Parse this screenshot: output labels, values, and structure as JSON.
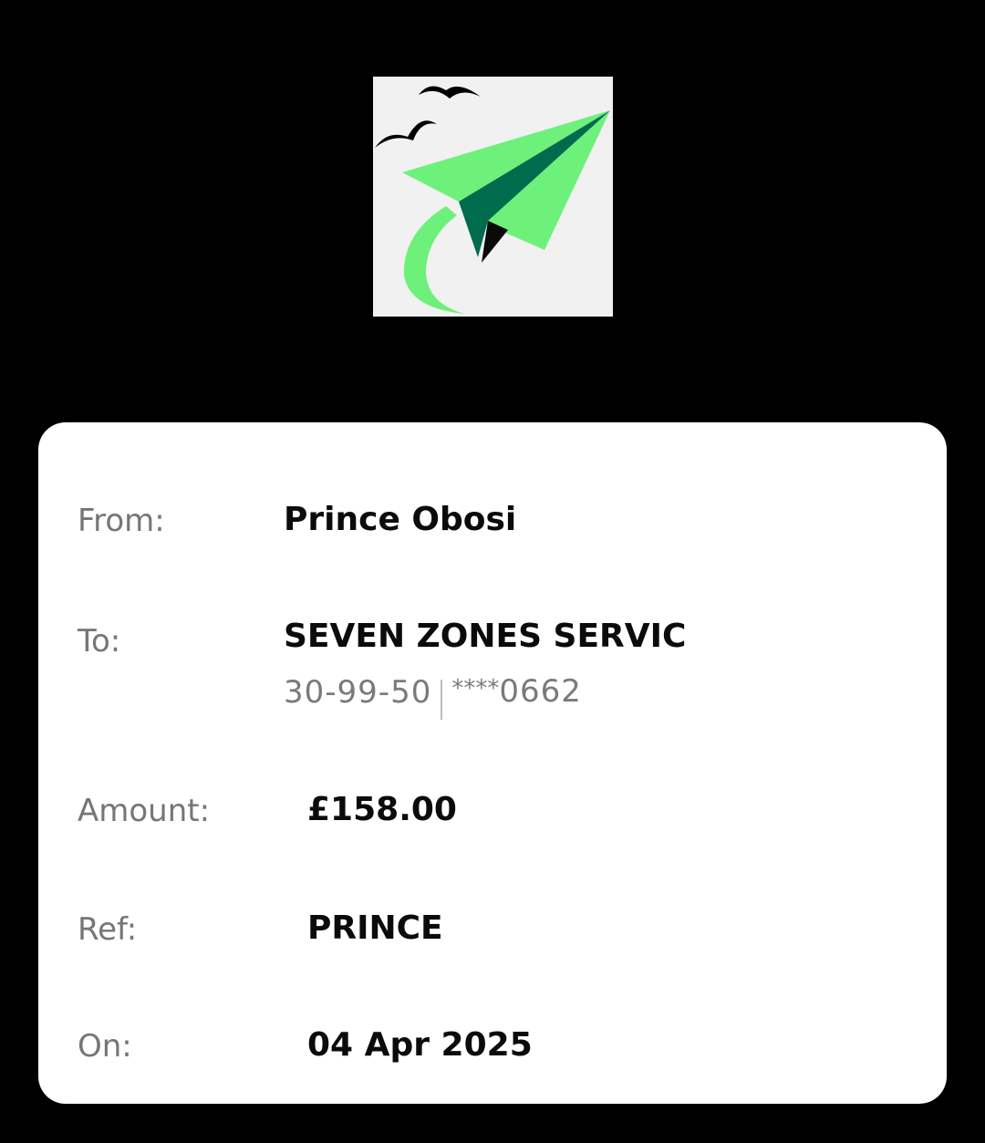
{
  "logo": {
    "icon": "paper-plane-with-birds",
    "colors": {
      "background": "#f1f1f1",
      "plane_light": "#6ef17a",
      "plane_dark": "#006b4d",
      "birds": "#000000"
    }
  },
  "receipt": {
    "from": {
      "label": "From:",
      "value": "Prince Obosi"
    },
    "to": {
      "label": "To:",
      "value": "SEVEN ZONES SERVIC",
      "sort_code": "30-99-50",
      "account_mask": "****",
      "account_suffix": "0662"
    },
    "amount": {
      "label": "Amount:",
      "value": "£158.00"
    },
    "ref": {
      "label": "Ref:",
      "value": "PRINCE"
    },
    "on": {
      "label": "On:",
      "value": "04 Apr 2025"
    }
  }
}
